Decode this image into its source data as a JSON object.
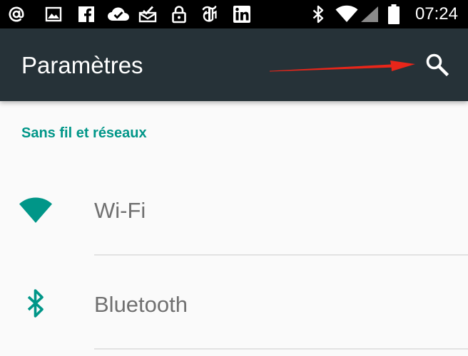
{
  "status_bar": {
    "time": "07:24",
    "notification_icons": [
      "at-sign-icon",
      "image-icon",
      "facebook-icon",
      "cloud-check-icon",
      "mail-check-icon",
      "lock-icon",
      "nytimes-icon",
      "linkedin-icon"
    ],
    "system_icons": [
      "bluetooth-icon",
      "wifi-signal-icon",
      "cellular-signal-icon",
      "battery-icon"
    ]
  },
  "app_bar": {
    "title": "Paramètres",
    "search_icon": "search-icon",
    "background": "#263238"
  },
  "annotation": {
    "arrow_color": "#e8261a"
  },
  "sections": [
    {
      "header": "Sans fil et réseaux",
      "header_color": "#009688",
      "items": [
        {
          "label": "Wi-Fi",
          "icon": "wifi-icon"
        },
        {
          "label": "Bluetooth",
          "icon": "bluetooth-icon"
        }
      ]
    }
  ]
}
